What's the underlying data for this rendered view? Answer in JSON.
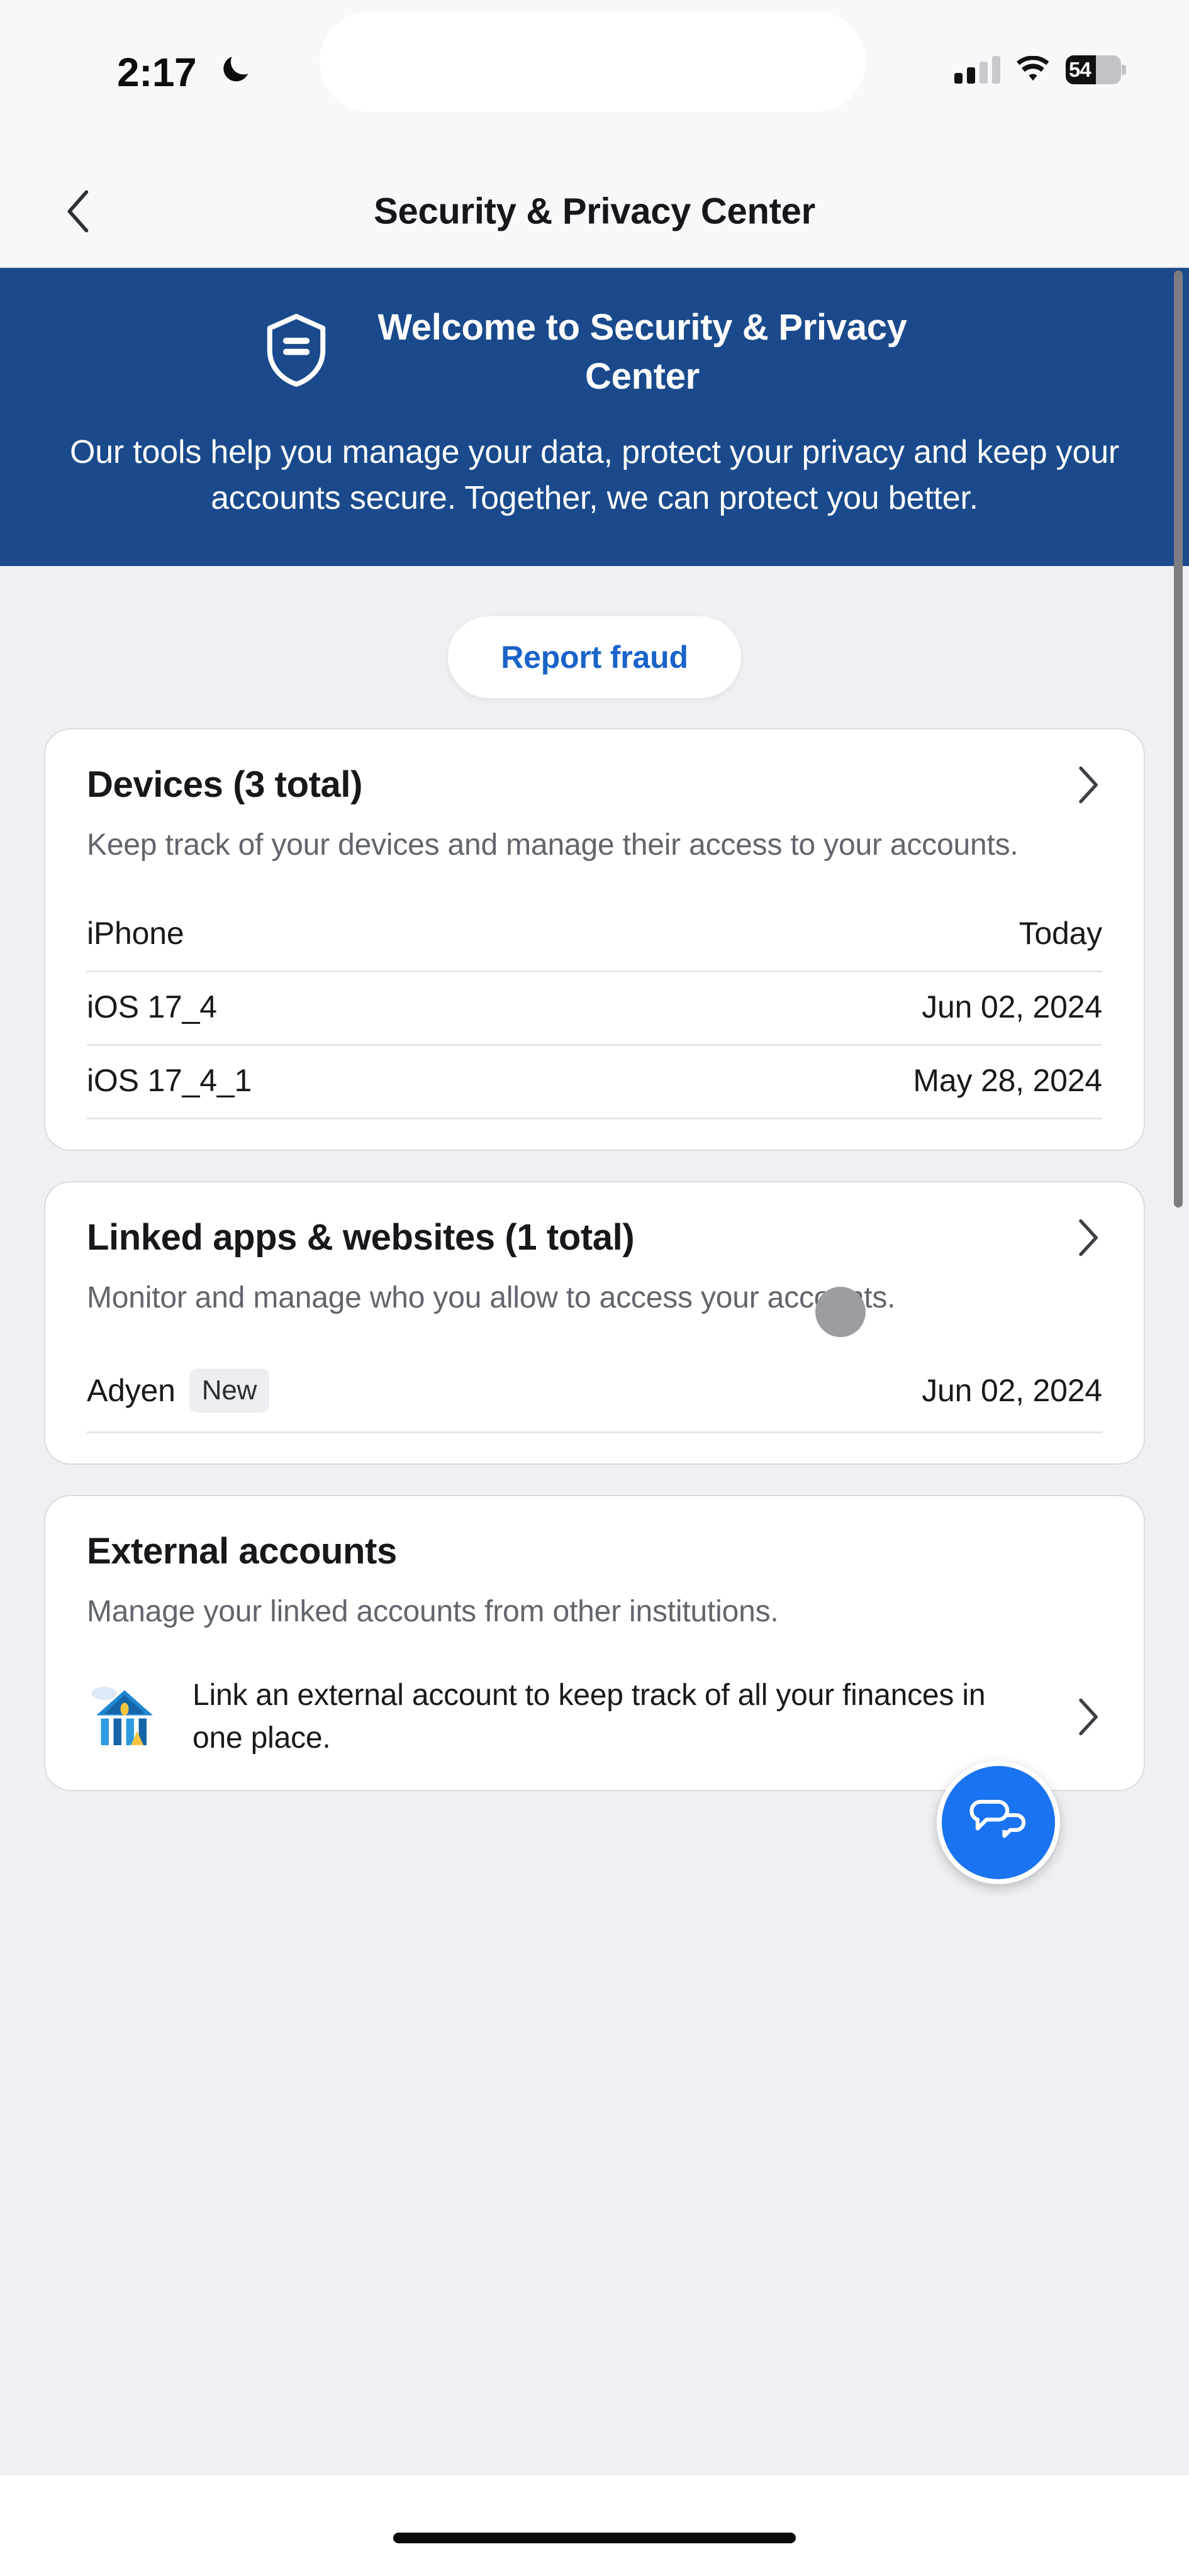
{
  "status_bar": {
    "time": "2:17",
    "moon_icon": "crescent-moon-icon",
    "signal_icon": "cellular-signal-icon",
    "signal_bars_filled": 2,
    "signal_bars_total": 4,
    "wifi_icon": "wifi-icon",
    "battery_icon": "battery-icon",
    "battery_percent": "54"
  },
  "nav": {
    "back_icon": "chevron-left-icon",
    "title": "Security & Privacy Center"
  },
  "hero": {
    "shield_icon": "shield-icon",
    "title": "Welcome to Security & Privacy Center",
    "body": "Our tools help you manage your data, protect your privacy and keep your accounts secure. Together, we can protect you better.",
    "background_color": "#1a4a8c"
  },
  "report_fraud": {
    "label": "Report fraud",
    "text_color": "#1a63c9"
  },
  "cards": [
    {
      "title": "Devices (3 total)",
      "chevron_icon": "chevron-right-icon",
      "description": "Keep track of your devices and manage their access to your accounts.",
      "rows": [
        {
          "label": "iPhone",
          "value": "Today"
        },
        {
          "label": "iOS 17_4",
          "value": "Jun 02, 2024"
        },
        {
          "label": "iOS 17_4_1",
          "value": "May 28, 2024"
        }
      ]
    },
    {
      "title": "Linked apps & websites (1 total)",
      "chevron_icon": "chevron-right-icon",
      "description": "Monitor and manage who you allow to access your accounts.",
      "rows": [
        {
          "label": "Adyen",
          "badge": "New",
          "value": "Jun 02, 2024"
        }
      ]
    },
    {
      "title": "External accounts",
      "description": "Manage your linked accounts from other institutions.",
      "promo": {
        "icon": "bank-building-icon",
        "text": "Link an external account to keep track of all your finances in one place.",
        "chevron_icon": "chevron-right-icon"
      }
    }
  ],
  "chat_fab": {
    "icon": "chat-bubbles-icon",
    "background_color": "#1a73f0"
  },
  "touch_indicator": {
    "name": "touch-point-indicator"
  },
  "home_indicator": {
    "name": "home-indicator"
  }
}
